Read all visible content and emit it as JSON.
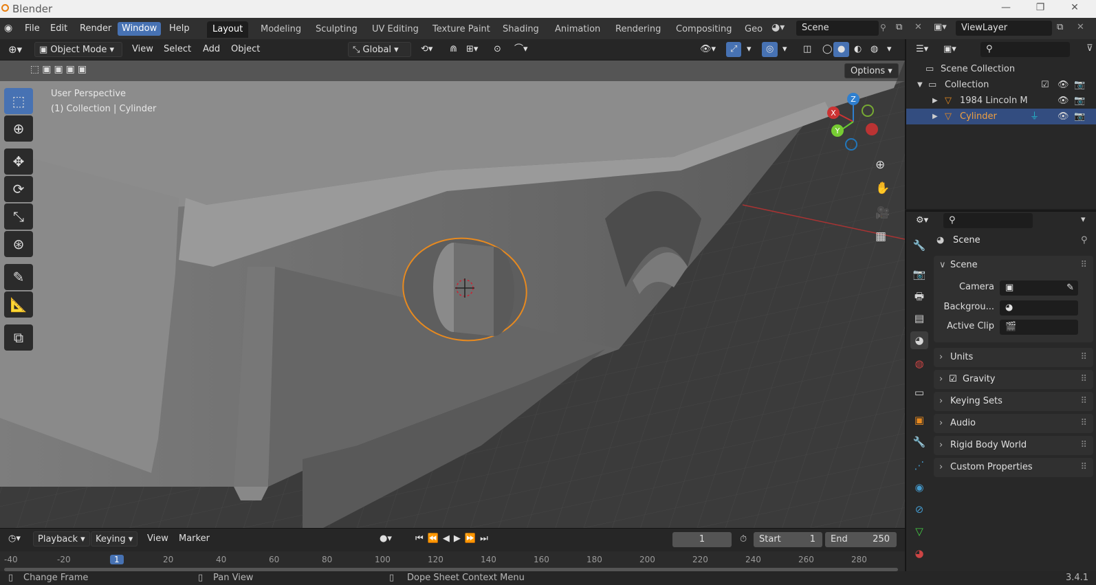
{
  "app": {
    "title": "Blender",
    "version": "3.4.1"
  },
  "menu": [
    "File",
    "Edit",
    "Render",
    "Window",
    "Help"
  ],
  "menu_active": "Window",
  "workspaces": [
    "Layout",
    "Modeling",
    "Sculpting",
    "UV Editing",
    "Texture Paint",
    "Shading",
    "Animation",
    "Rendering",
    "Compositing",
    "Geo"
  ],
  "workspace_active": "Layout",
  "scene_field": "Scene",
  "viewlayer_field": "ViewLayer",
  "viewport_header": {
    "mode": "Object Mode",
    "view": "View",
    "select": "Select",
    "add": "Add",
    "object": "Object",
    "orientation": "Global",
    "options": "Options"
  },
  "viewport": {
    "perspective": "User Perspective",
    "context": "(1) Collection | Cylinder"
  },
  "gizmo": {
    "x": "X",
    "y": "Y",
    "z": "Z"
  },
  "outliner": {
    "scene_collection": "Scene Collection",
    "collection": "Collection",
    "items": [
      {
        "label": "1984 Lincoln M"
      },
      {
        "label": "Cylinder"
      }
    ]
  },
  "properties": {
    "header": "Scene",
    "scene_panel": "Scene",
    "camera_label": "Camera",
    "background_label": "Backgrou...",
    "active_clip_label": "Active Clip",
    "panels": [
      "Units",
      "Gravity",
      "Keying Sets",
      "Audio",
      "Rigid Body World",
      "Custom Properties"
    ]
  },
  "timeline": {
    "playback": "Playback",
    "keying": "Keying",
    "view": "View",
    "marker": "Marker",
    "current_frame": "1",
    "start_label": "Start",
    "start": "1",
    "end_label": "End",
    "end": "250",
    "ruler": [
      "-40",
      "-20",
      "1",
      "20",
      "40",
      "60",
      "80",
      "100",
      "120",
      "140",
      "160",
      "180",
      "200",
      "220",
      "240",
      "260",
      "280"
    ]
  },
  "status": {
    "left": "Change Frame",
    "middle": "Pan View",
    "right": "Dope Sheet Context Menu"
  },
  "colors": {
    "accent": "#4772b3",
    "selected": "#e88a1f",
    "background": "#3b3b3b"
  }
}
